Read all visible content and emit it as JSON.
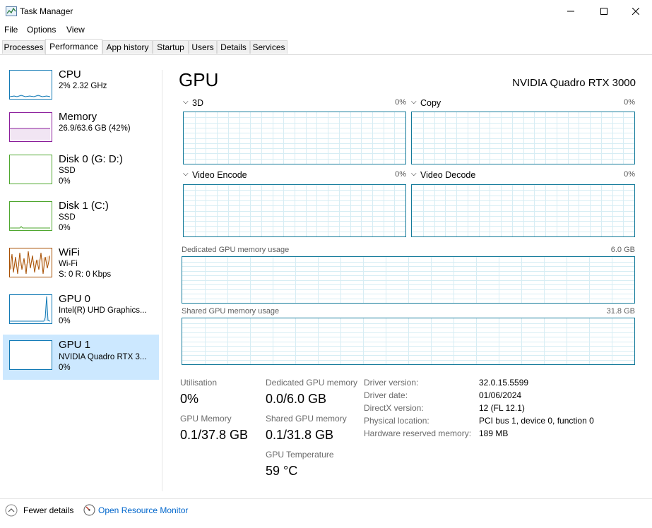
{
  "window": {
    "title": "Task Manager"
  },
  "menu": [
    "File",
    "Options",
    "View"
  ],
  "tabs": [
    "Processes",
    "Performance",
    "App history",
    "Startup",
    "Users",
    "Details",
    "Services"
  ],
  "sidebar": [
    {
      "title": "CPU",
      "sub1": "2%  2.32 GHz",
      "sub2": "",
      "sub3": "",
      "color": "#1179b5"
    },
    {
      "title": "Memory",
      "sub1": "26.9/63.6 GB (42%)",
      "sub2": "",
      "sub3": "",
      "color": "#8b1c9b"
    },
    {
      "title": "Disk 0 (G: D:)",
      "sub1": "SSD",
      "sub2": "0%",
      "sub3": "",
      "color": "#4ea72e"
    },
    {
      "title": "Disk 1 (C:)",
      "sub1": "SSD",
      "sub2": "0%",
      "sub3": "",
      "color": "#4ea72e"
    },
    {
      "title": "WiFi",
      "sub1": "Wi-Fi",
      "sub2": "S: 0 R: 0 Kbps",
      "sub3": "",
      "color": "#a74f01"
    },
    {
      "title": "GPU 0",
      "sub1": "Intel(R) UHD Graphics...",
      "sub2": "0%",
      "sub3": "",
      "color": "#1179b5"
    },
    {
      "title": "GPU 1",
      "sub1": "NVIDIA Quadro RTX 3...",
      "sub2": "0%",
      "sub3": "",
      "color": "#1179b5"
    }
  ],
  "main": {
    "title": "GPU",
    "model": "NVIDIA Quadro RTX 3000",
    "engines": [
      {
        "label": "3D",
        "pct": "0%"
      },
      {
        "label": "Copy",
        "pct": "0%"
      },
      {
        "label": "Video Encode",
        "pct": "0%"
      },
      {
        "label": "Video Decode",
        "pct": "0%"
      }
    ],
    "dedicated_label": "Dedicated GPU memory usage",
    "dedicated_max": "6.0 GB",
    "shared_label": "Shared GPU memory usage",
    "shared_max": "31.8 GB",
    "stats": {
      "utilisation_label": "Utilisation",
      "utilisation_value": "0%",
      "gpu_memory_label": "GPU Memory",
      "gpu_memory_value": "0.1/37.8 GB",
      "dedicated_label": "Dedicated GPU memory",
      "dedicated_value": "0.0/6.0 GB",
      "shared_label": "Shared GPU memory",
      "shared_value": "0.1/31.8 GB",
      "temp_label": "GPU Temperature",
      "temp_value": "59 °C"
    },
    "info": [
      {
        "key": "Driver version:",
        "value": "32.0.15.5599"
      },
      {
        "key": "Driver date:",
        "value": "01/06/2024"
      },
      {
        "key": "DirectX version:",
        "value": "12 (FL 12.1)"
      },
      {
        "key": "Physical location:",
        "value": "PCI bus 1, device 0, function 0"
      },
      {
        "key": "Hardware reserved memory:",
        "value": "189 MB"
      }
    ]
  },
  "footer": {
    "fewer_details": "Fewer details",
    "resource_monitor": "Open Resource Monitor"
  },
  "colors": {
    "accent": "#137a9a",
    "selected_bg": "#cce8ff",
    "link": "#0066cc"
  }
}
